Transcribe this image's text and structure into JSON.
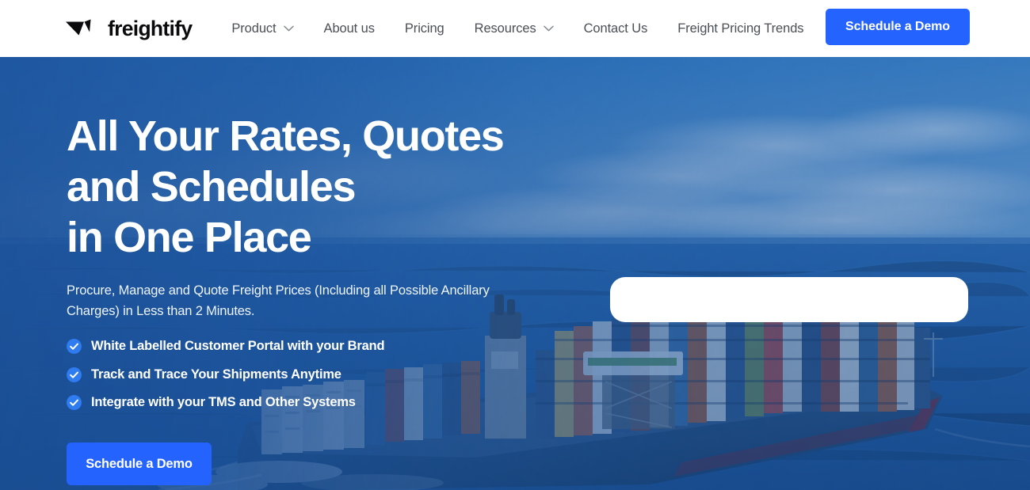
{
  "header": {
    "brand": {
      "name": "freightify",
      "logo_icon": "freightify-arrow-logo"
    },
    "nav": [
      {
        "label": "Product",
        "has_dropdown": true,
        "icon": "chevron-down-icon"
      },
      {
        "label": "About us",
        "has_dropdown": false
      },
      {
        "label": "Pricing",
        "has_dropdown": false
      },
      {
        "label": "Resources",
        "has_dropdown": true,
        "icon": "chevron-down-icon"
      },
      {
        "label": "Contact Us",
        "has_dropdown": false
      },
      {
        "label": "Freight Pricing Trends",
        "has_dropdown": false
      }
    ],
    "cta_label": "Schedule a Demo"
  },
  "hero": {
    "title_lines": [
      "All Your Rates, Quotes",
      "and Schedules",
      "in One Place"
    ],
    "subtitle": "Procure, Manage and Quote Freight Prices (Including all Possible Ancillary Charges) in Less than 2 Minutes.",
    "benefits": [
      {
        "label": "White Labelled Customer Portal with your Brand",
        "icon": "check-circle-icon"
      },
      {
        "label": "Track and Trace Your Shipments Anytime",
        "icon": "check-circle-icon"
      },
      {
        "label": "Integrate with your TMS and Other Systems",
        "icon": "check-circle-icon"
      }
    ],
    "cta_label": "Schedule a Demo",
    "background_image": "container-ship-at-sea-photo",
    "panel": {
      "content": "",
      "state": "empty"
    }
  },
  "colors": {
    "brand_blue": "#2563ff",
    "hero_overlay_blue": "#1e56a0",
    "text_dark": "#0b0b0d",
    "nav_text": "#4b4f56",
    "white": "#ffffff"
  }
}
